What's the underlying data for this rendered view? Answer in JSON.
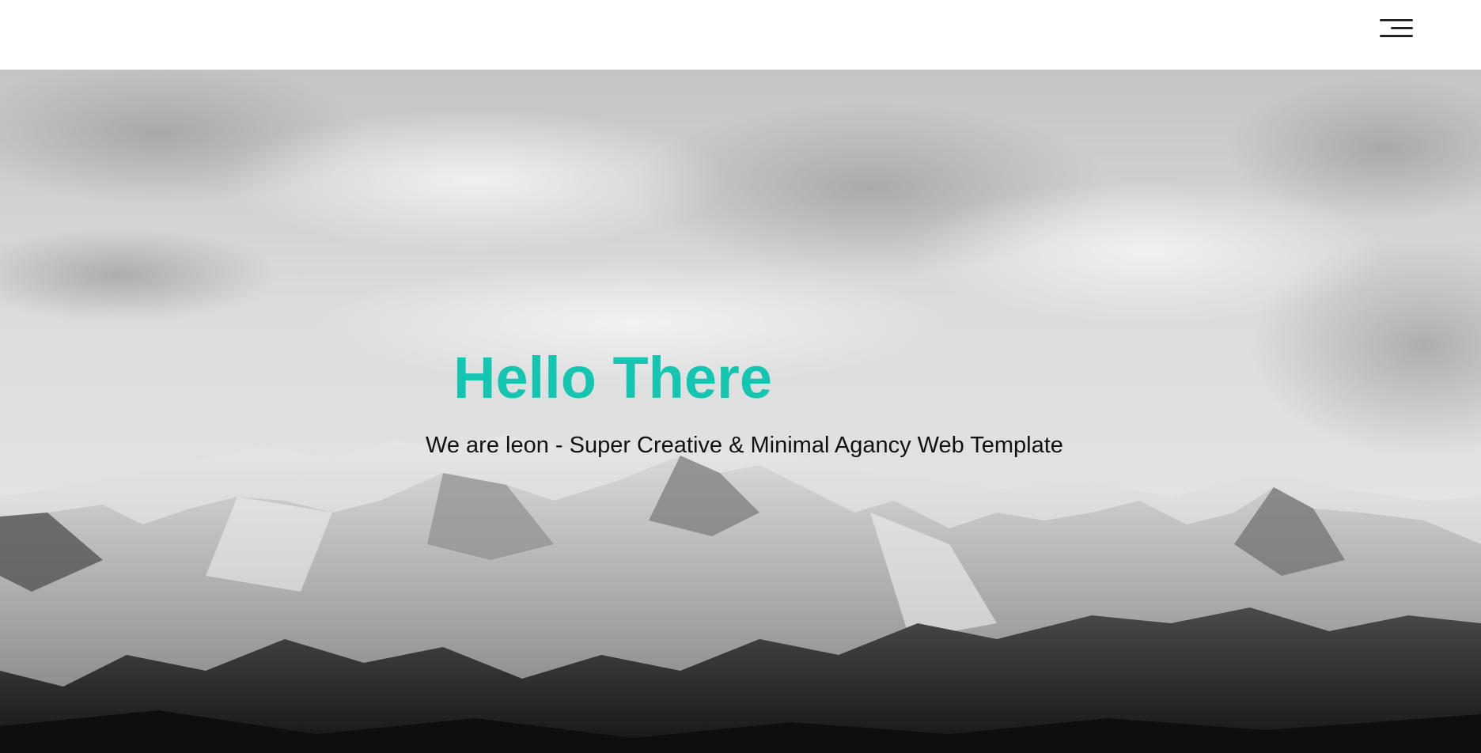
{
  "header": {
    "menu_icon": "hamburger-menu-icon"
  },
  "hero": {
    "background": "snowy-mountains-grayscale",
    "title": "Hello There",
    "subtitle": "We are leon - Super Creative & Minimal Agancy Web Template"
  },
  "colors": {
    "accent": "#14c6b2",
    "text": "#111111",
    "header_bg": "#ffffff",
    "icon": "#222222"
  }
}
